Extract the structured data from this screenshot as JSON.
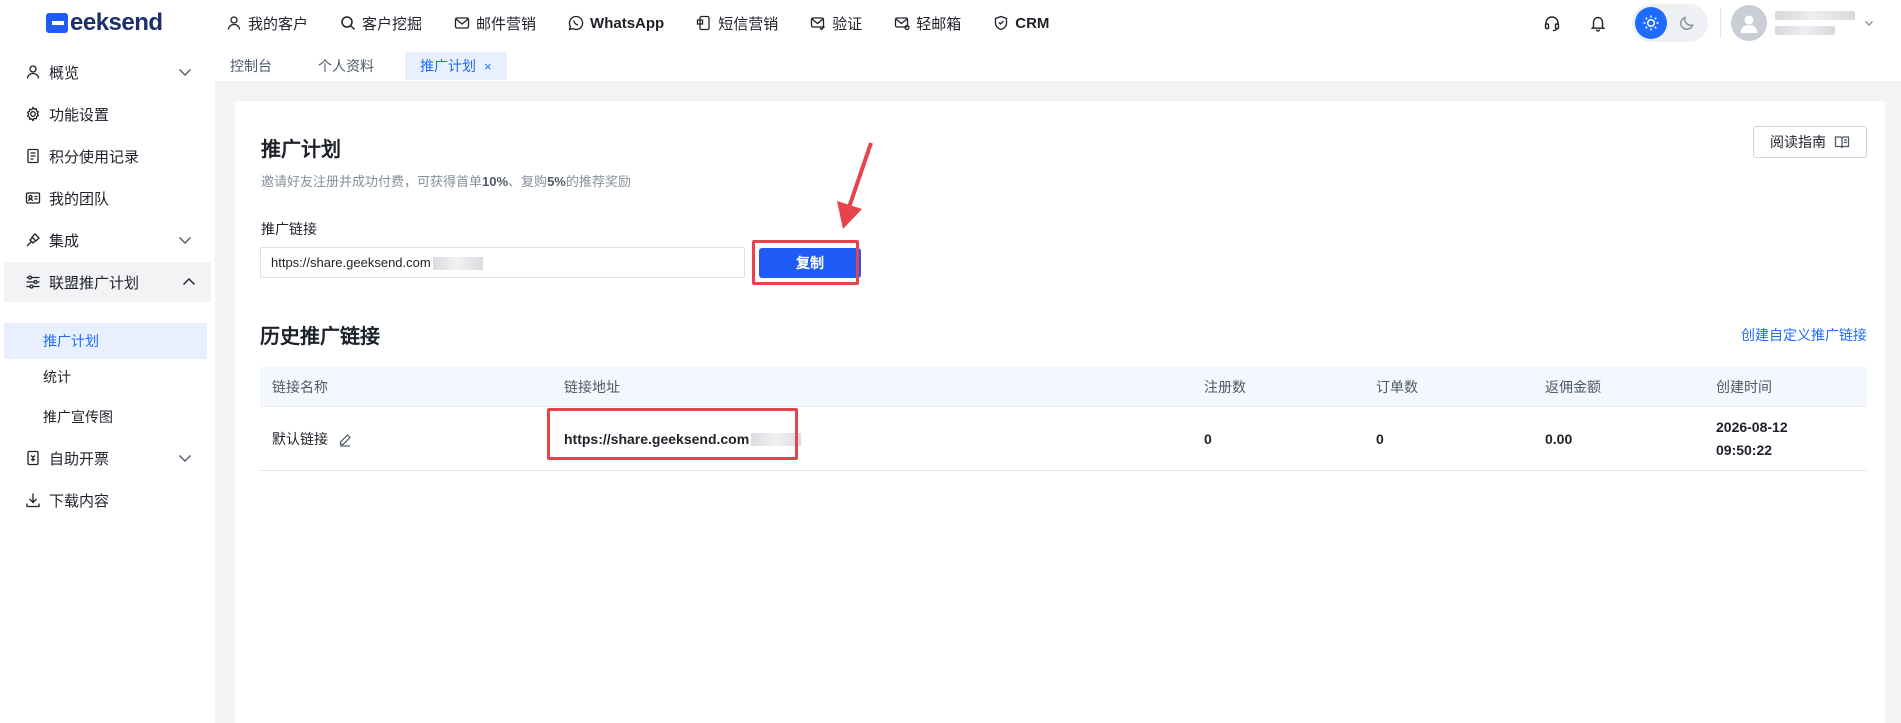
{
  "brand": {
    "logo_text": "eeksend",
    "accent": "#1f5cf5"
  },
  "nav": [
    {
      "label": "我的客户",
      "icon": "user-icon"
    },
    {
      "label": "客户挖掘",
      "icon": "search-icon"
    },
    {
      "label": "邮件营销",
      "icon": "mail-icon"
    },
    {
      "label": "WhatsApp",
      "icon": "whatsapp-icon"
    },
    {
      "label": "短信营销",
      "icon": "sms-icon"
    },
    {
      "label": "验证",
      "icon": "verify-mail-icon"
    },
    {
      "label": "轻邮箱",
      "icon": "light-mail-icon"
    },
    {
      "label": "CRM",
      "icon": "shield-icon"
    }
  ],
  "subtabs": [
    {
      "label": "控制台"
    },
    {
      "label": "个人资料"
    },
    {
      "label": "推广计划",
      "active": true,
      "close": "×"
    }
  ],
  "sidebar": {
    "items": [
      {
        "label": "概览",
        "icon": "user-icon",
        "arrow": "down"
      },
      {
        "label": "功能设置",
        "icon": "gear-icon"
      },
      {
        "label": "积分使用记录",
        "icon": "document-icon"
      },
      {
        "label": "我的团队",
        "icon": "id-card-icon"
      },
      {
        "label": "集成",
        "icon": "plug-icon",
        "arrow": "down"
      },
      {
        "label": "联盟推广计划",
        "icon": "sliders-icon",
        "arrow": "up",
        "open": true
      },
      {
        "label": "自助开票",
        "icon": "invoice-icon",
        "arrow": "down"
      },
      {
        "label": "下载内容",
        "icon": "download-icon"
      }
    ],
    "sub_items": [
      {
        "label": "推广计划",
        "active": true
      },
      {
        "label": "统计"
      },
      {
        "label": "推广宣传图"
      }
    ]
  },
  "main": {
    "title": "推广计划",
    "desc_1": "邀请好友注册并成功付费，可获得首单",
    "desc_2": "10%",
    "desc_3": "、复购",
    "desc_4": "5%",
    "desc_5": "的推荐奖励",
    "guide_button": "阅读指南",
    "link_label": "推广链接",
    "link_value": "https://share.geeksend.com",
    "copy_button": "复制",
    "history_title": "历史推广链接",
    "create_link": "创建自定义推广链接"
  },
  "table": {
    "headers": [
      "链接名称",
      "链接地址",
      "注册数",
      "订单数",
      "返佣金额",
      "创建时间"
    ],
    "rows": [
      {
        "name": "默认链接",
        "url": "https://share.geeksend.com",
        "registrations": "0",
        "orders": "0",
        "commission": "0.00",
        "date": "2026-08-12",
        "time": "09:50:22"
      }
    ]
  },
  "colors": {
    "highlight": "#e8424a",
    "link": "#1f6bff"
  }
}
